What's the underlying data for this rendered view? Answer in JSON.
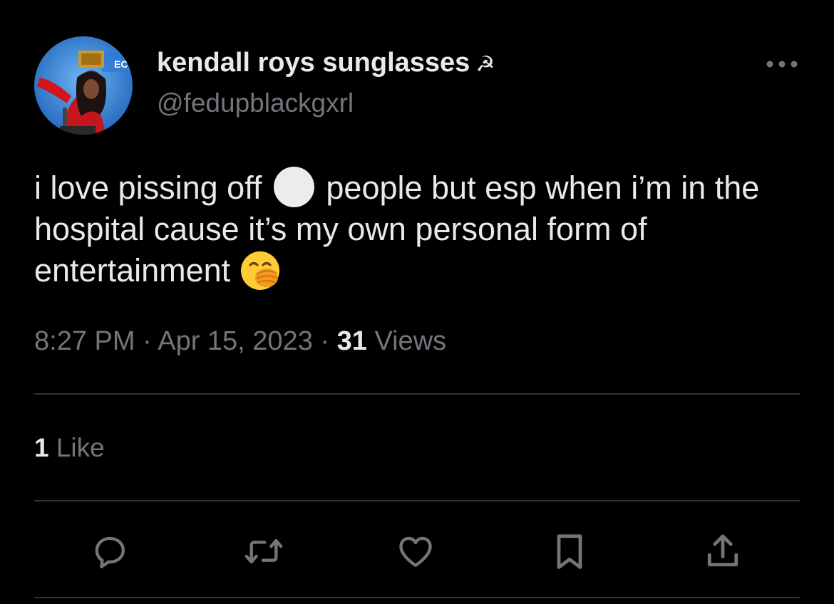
{
  "tweet": {
    "display_name": "kendall roys sunglasses",
    "name_symbol": "☭",
    "handle": "@fedupblackgxrl",
    "text_parts": {
      "p1": "i love pissing off",
      "p2": "people but esp when i’m in the hospital cause it’s my own personal form of entertainment"
    },
    "inline_glyph_1": "white-circle-emoji",
    "inline_glyph_2": "face-with-hand-over-mouth-emoji"
  },
  "meta": {
    "time": "8:27 PM",
    "separator": "·",
    "date": "Apr 15, 2023",
    "views_count": "31",
    "views_label": "Views"
  },
  "engagement": {
    "likes_count": "1",
    "likes_label": "Like"
  },
  "actions": [
    "reply-icon",
    "retweet-icon",
    "like-icon",
    "bookmark-icon",
    "share-icon"
  ],
  "colors": {
    "background": "#000000",
    "text_primary": "#e7e9ea",
    "text_secondary": "#71767b",
    "divider": "#2f3336"
  }
}
